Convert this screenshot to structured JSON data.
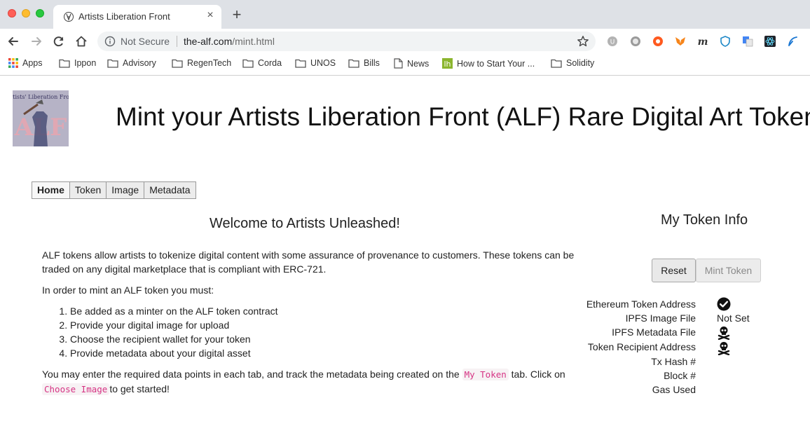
{
  "browser": {
    "tab_title": "Artists Liberation Front",
    "new_tab_label": "+",
    "tab_close_label": "×",
    "security_label": "Not Secure",
    "url_host": "the-alf.com",
    "url_path": "/mint.html",
    "bookmarks": [
      {
        "label": "Apps",
        "icon": "apps-grid-icon"
      },
      {
        "label": "Ippon",
        "icon": "folder-icon"
      },
      {
        "label": "Advisory",
        "icon": "folder-icon"
      },
      {
        "label": "RegenTech",
        "icon": "folder-icon"
      },
      {
        "label": "Corda",
        "icon": "folder-icon"
      },
      {
        "label": "UNOS",
        "icon": "folder-icon"
      },
      {
        "label": "Bills",
        "icon": "folder-icon"
      },
      {
        "label": "News",
        "icon": "page-icon"
      },
      {
        "label": "How to Start Your ...",
        "icon": "lh-icon"
      },
      {
        "label": "Solidity",
        "icon": "folder-icon"
      }
    ]
  },
  "page": {
    "logo_text": "Artists' Liberation Front",
    "logo_letters": "ALF",
    "title": "Mint your Artists Liberation Front (ALF) Rare Digital Art Token",
    "tabs": [
      {
        "label": "Home",
        "active": true
      },
      {
        "label": "Token",
        "active": false
      },
      {
        "label": "Image",
        "active": false
      },
      {
        "label": "Metadata",
        "active": false
      }
    ],
    "welcome": "Welcome to Artists Unleashed!",
    "intro": "ALF tokens allow artists to tokenize digital content with some assurance of provenance to customers. These tokens can be traded on any digital marketplace that is compliant with ERC-721.",
    "steps_intro": "In order to mint an ALF token you must:",
    "steps": [
      "Be added as a minter on the ALF token contract",
      "Provide your digital image for upload",
      "Choose the recipient wallet for your token",
      "Provide metadata about your digital asset"
    ],
    "outro_part1": "You may enter the required data points in each tab, and track the metadata being created on the",
    "outro_code1": "My Token",
    "outro_part2": "tab. Click on",
    "outro_code2": "Choose Image",
    "outro_part3": "to get started!"
  },
  "token_info": {
    "title": "My Token Info",
    "reset_label": "Reset",
    "mint_label": "Mint Token",
    "fields": [
      {
        "label": "Ethereum Token Address",
        "status": "check-icon"
      },
      {
        "label": "IPFS Image File",
        "value": "Not Set"
      },
      {
        "label": "IPFS Metadata File",
        "status": "skull-crossbones-icon"
      },
      {
        "label": "Token Recipient Address",
        "status": "skull-crossbones-icon"
      },
      {
        "label": "Tx Hash #"
      },
      {
        "label": "Block #"
      },
      {
        "label": "Gas Used"
      }
    ]
  }
}
